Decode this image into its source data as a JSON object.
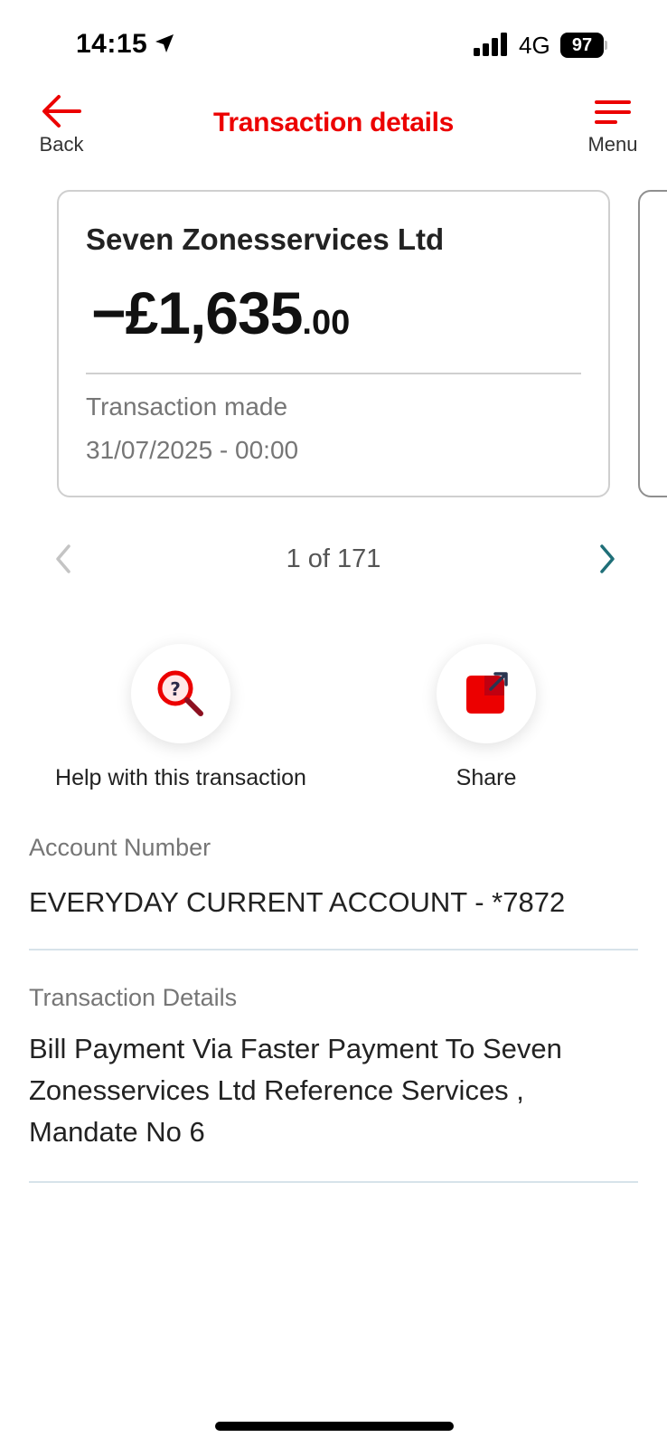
{
  "status_bar": {
    "time": "14:15",
    "network": "4G",
    "battery": "97"
  },
  "header": {
    "back_label": "Back",
    "title": "Transaction details",
    "menu_label": "Menu"
  },
  "transaction": {
    "merchant": "Seven Zonesservices Ltd",
    "amount_main": "−£1,635",
    "amount_pence": ".00",
    "made_label": "Transaction made",
    "made_date": "31/07/2025 - 00:00"
  },
  "pager": {
    "text": "1 of 171"
  },
  "actions": {
    "help_label": "Help with this transaction",
    "share_label": "Share"
  },
  "details": {
    "account_label": "Account Number",
    "account_value": "EVERYDAY CURRENT ACCOUNT - *7872",
    "txn_label": "Transaction Details",
    "txn_value": "Bill Payment Via Faster Payment To Seven Zonesservices Ltd Reference Services , Mandate No 6"
  },
  "colors": {
    "brand": "#ec0000",
    "accent_teal": "#1f6f78",
    "muted_text": "#767676"
  }
}
